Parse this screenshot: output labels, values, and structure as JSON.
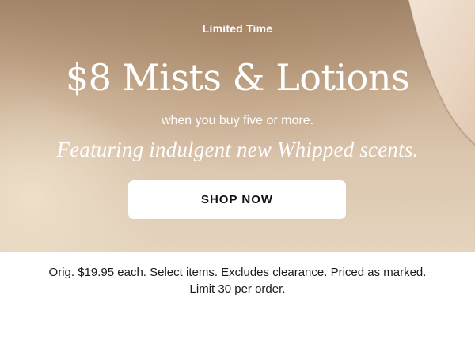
{
  "promo": {
    "kicker": "Limited Time",
    "headline": "$8 Mists & Lotions",
    "subline": "when you buy five or more.",
    "tagline": "Featuring indulgent new Whipped scents.",
    "cta_label": "SHOP NOW"
  },
  "fineprint": {
    "text": "Orig. $19.95 each. Select items. Excludes clearance. Priced as marked. Limit 30 per order."
  },
  "colors": {
    "banner_top": "#b99c7f",
    "banner_bottom": "#e5d4be",
    "cta_background": "#ffffff",
    "text_dark": "#111111"
  }
}
